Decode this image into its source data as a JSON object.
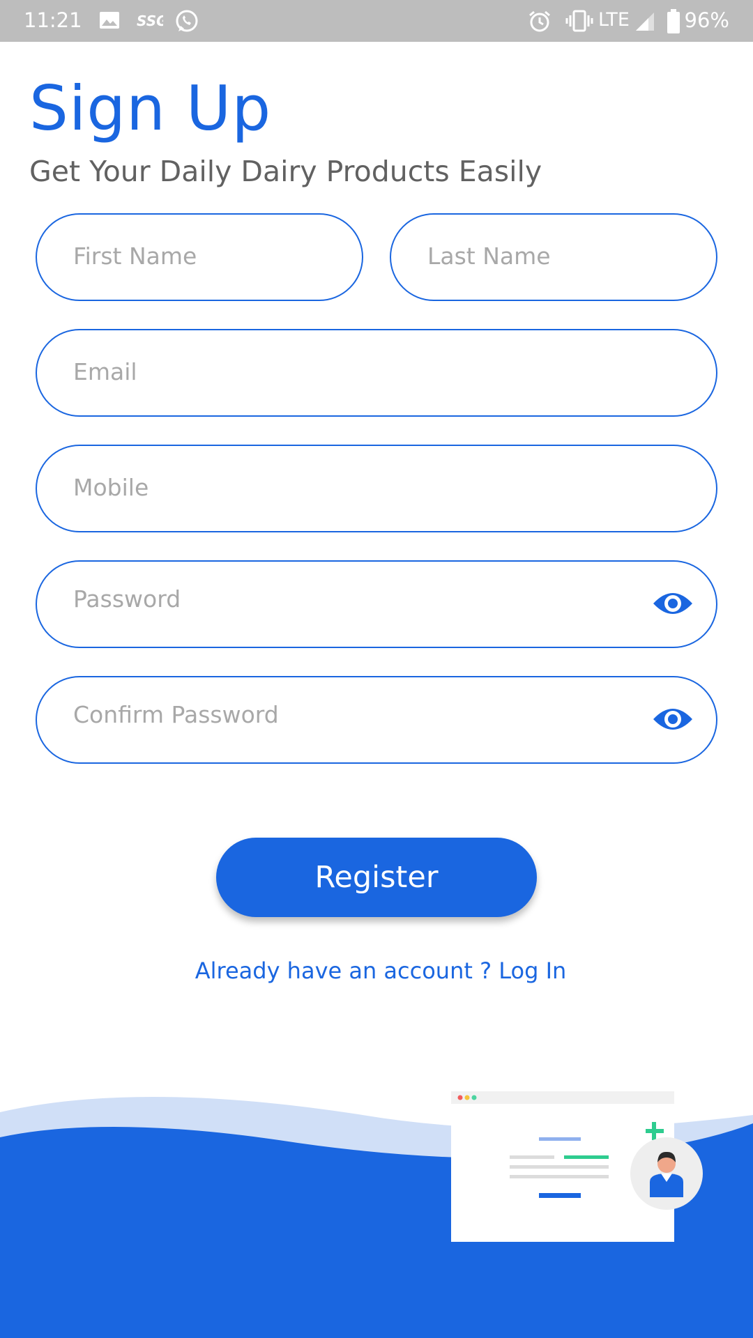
{
  "status_bar": {
    "time": "11:21",
    "network": "LTE",
    "battery": "96%",
    "icons": [
      "image-icon",
      "ssg-icon",
      "whatsapp-icon",
      "alarm-icon",
      "vibrate-icon",
      "signal-icon",
      "battery-icon"
    ],
    "ssg_label": "SSG"
  },
  "header": {
    "title": "Sign Up",
    "subtitle": "Get Your Daily Dairy Products Easily"
  },
  "form": {
    "first_name_placeholder": "First Name",
    "last_name_placeholder": "Last Name",
    "email_placeholder": "Email",
    "mobile_placeholder": "Mobile",
    "password_placeholder": "Password",
    "confirm_password_placeholder": "Confirm Password",
    "show_password_icon": "eye-icon"
  },
  "actions": {
    "register_label": "Register",
    "login_prompt": "Already have an account ? Log In"
  },
  "colors": {
    "primary": "#1a66e0",
    "wave_light": "#d0dff7",
    "placeholder": "#a8a8a8",
    "status_bar": "#bdbdbd",
    "accent_green": "#2ecc8f"
  }
}
